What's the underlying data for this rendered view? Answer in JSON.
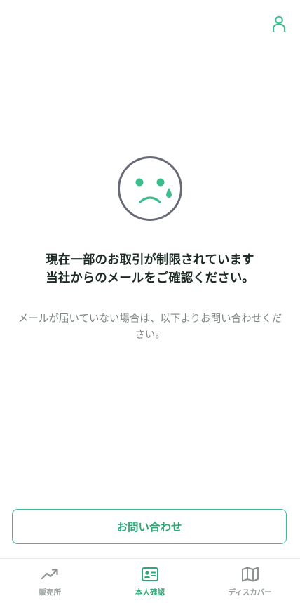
{
  "header": {
    "account_icon": "person-icon"
  },
  "status": {
    "face_icon": "sad-face-icon",
    "headline_line1": "現在一部のお取引が制限されています",
    "headline_line2": "当社からのメールをご確認ください。",
    "description": "メールが届いていない場合は、以下よりお問い合わせください。"
  },
  "actions": {
    "contact_label": "お問い合わせ"
  },
  "tabbar": {
    "items": [
      {
        "label": "販売所",
        "icon": "trending-up-icon",
        "active": false
      },
      {
        "label": "本人確認",
        "icon": "id-card-icon",
        "active": true
      },
      {
        "label": "ディスカバー",
        "icon": "map-icon",
        "active": false
      }
    ]
  },
  "colors": {
    "accent": "#3dbd8c",
    "text_dark": "#1d2b24",
    "text_muted": "#7d8580",
    "inactive": "#9aa19d"
  }
}
